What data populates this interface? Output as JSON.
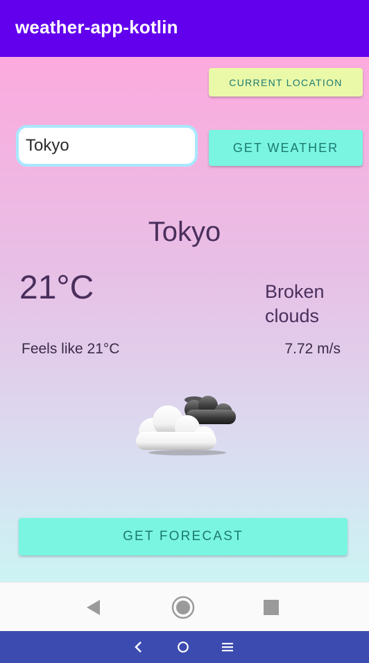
{
  "app_bar": {
    "title": "weather-app-kotlin"
  },
  "location_button": {
    "label": "CURRENT LOCATION"
  },
  "search": {
    "value": "Tokyo"
  },
  "weather_button": {
    "label": "GET WEATHER"
  },
  "weather": {
    "city": "Tokyo",
    "temperature": "21°C",
    "description": "Broken clouds",
    "feels_like": "Feels like 21°C",
    "wind_speed": "7.72 m/s",
    "icon": "broken-clouds-icon"
  },
  "forecast_button": {
    "label": "GET FORECAST"
  },
  "navigation": {
    "icons": [
      "back-triangle-icon",
      "home-circle-icon",
      "recents-square-icon"
    ]
  },
  "system_bar": {
    "icons": [
      "back-chevron-icon",
      "home-icon",
      "menu-icon"
    ]
  },
  "colors": {
    "app_bar": "#6200ee",
    "gradient_top": "#fcaade",
    "gradient_bottom": "#ccf4f4",
    "location_button": "#eaf9a8",
    "action_button": "#7af5e2",
    "button_text": "#1b7a72",
    "input_border": "#a8e7ff",
    "text": "#4a2f5c",
    "system_bar": "#3c4bb0"
  }
}
